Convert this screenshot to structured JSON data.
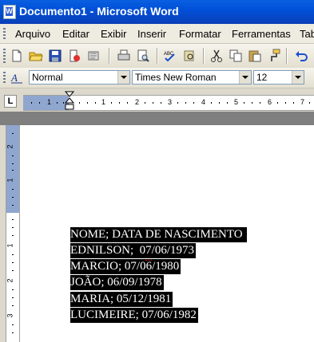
{
  "window": {
    "title": "Documento1 - Microsoft Word",
    "app_icon_letter": "W"
  },
  "menu": [
    "Arquivo",
    "Editar",
    "Exibir",
    "Inserir",
    "Formatar",
    "Ferramentas",
    "Tab"
  ],
  "toolbar_icons": [
    "new-document-icon",
    "open-folder-icon",
    "save-icon",
    "permission-icon",
    "email-icon",
    "print-icon",
    "print-preview-icon",
    "spelling-icon",
    "research-icon",
    "cut-icon",
    "copy-icon",
    "paste-icon",
    "format-painter-icon",
    "undo-icon"
  ],
  "formatting": {
    "styles_icon": "A",
    "style": "Normal",
    "font": "Times New Roman",
    "size": "12"
  },
  "ruler": {
    "corner": "L",
    "h_numbers": [
      "1",
      "1",
      "2",
      "3",
      "4",
      "5",
      "6",
      "7"
    ],
    "v_numbers": [
      "2",
      "1",
      "1",
      "2",
      "3"
    ]
  },
  "document": {
    "lines": [
      "NOME; DATA DE NASCIMENTO ",
      "EDNILSON;  07/06/1973",
      "MARCIO; 07/06/1980",
      "JOÃO; 06/09/1978",
      "MARIA; 05/12/1981",
      "LUCIMEIRE; 07/06/1982"
    ]
  },
  "colors": {
    "titlebar": "#0054e3",
    "selection": "#000000",
    "ruler_margin": "#8fa6cf"
  }
}
